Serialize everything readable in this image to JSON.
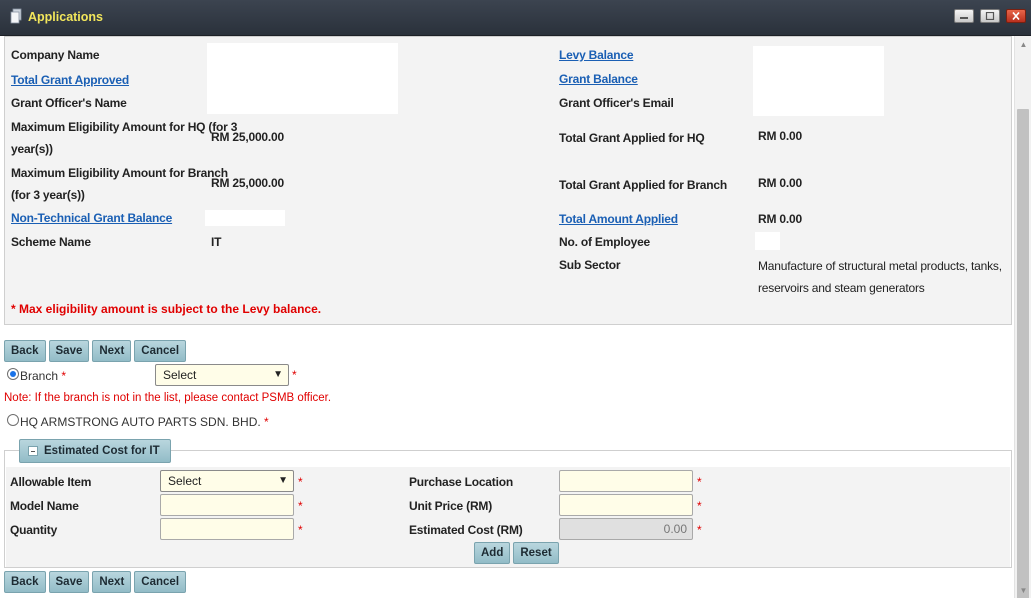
{
  "window": {
    "title": "Applications",
    "accent_color": "#f2e65b",
    "title_bar_color": "#333a44"
  },
  "info": {
    "company_name_label": "Company Name",
    "total_grant_approved_label": "Total Grant Approved",
    "grant_officer_name_label": "Grant Officer's Name",
    "max_eligibility_hq_label_line1": "Maximum Eligibility Amount for HQ (for 3",
    "max_eligibility_hq_label_line2": "year(s))",
    "max_eligibility_hq_value": "RM 25,000.00",
    "max_eligibility_branch_label_line1": "Maximum Eligibility Amount for Branch",
    "max_eligibility_branch_label_line2": "(for 3 year(s))",
    "max_eligibility_branch_value": "RM 25,000.00",
    "non_technical_grant_balance_label": "Non-Technical Grant Balance",
    "scheme_name_label": "Scheme Name",
    "scheme_name_value": "IT",
    "levy_balance_label": "Levy Balance",
    "grant_balance_label": "Grant Balance",
    "grant_officer_email_label": "Grant Officer's Email",
    "total_grant_applied_hq_label": "Total Grant Applied for HQ",
    "total_grant_applied_hq_value": "RM 0.00",
    "total_grant_applied_branch_label": "Total Grant Applied for Branch",
    "total_grant_applied_branch_value": "RM 0.00",
    "total_amount_applied_label": "Total Amount Applied",
    "total_amount_applied_value": "RM 0.00",
    "no_of_employee_label": "No. of Employee",
    "sub_sector_label": "Sub Sector",
    "sub_sector_value_line1": "Manufacture of structural metal products, tanks,",
    "sub_sector_value_line2": "reservoirs and steam generators",
    "levy_note": "* Max eligibility amount is subject to the Levy balance."
  },
  "buttons": {
    "back": "Back",
    "save": "Save",
    "next": "Next",
    "cancel": "Cancel"
  },
  "branch": {
    "label": "Branch",
    "required_mark": "*",
    "select_value": "Select",
    "note": "Note: If the branch is not in the list, please contact PSMB officer.",
    "hq_label": "HQ ARMSTRONG AUTO PARTS SDN. BHD.",
    "branch_selected": true
  },
  "estimated_cost": {
    "section_title": "Estimated Cost for IT",
    "allowable_item_label": "Allowable Item",
    "allowable_item_value": "Select",
    "model_name_label": "Model Name",
    "model_name_value": "",
    "quantity_label": "Quantity",
    "quantity_value": "",
    "purchase_location_label": "Purchase Location",
    "purchase_location_value": "",
    "unit_price_label": "Unit Price (RM)",
    "unit_price_value": "",
    "estimated_cost_label": "Estimated Cost (RM)",
    "estimated_cost_value": "0.00",
    "add_label": "Add",
    "reset_label": "Reset",
    "required_mark": "*"
  }
}
